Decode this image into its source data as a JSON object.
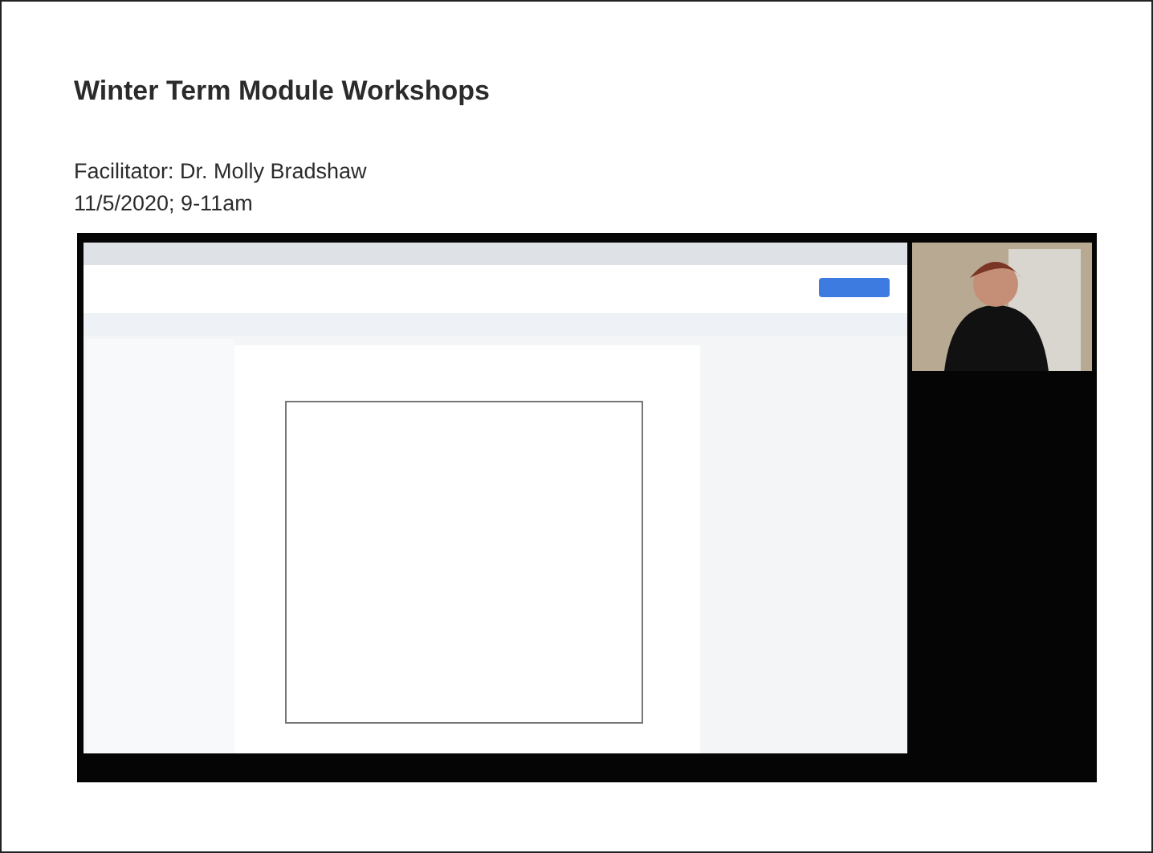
{
  "title": "Winter Term Module Workshops",
  "details": [
    "Facilitator: Dr. Molly Bradshaw",
    "11/5/2020; 9-11am"
  ]
}
